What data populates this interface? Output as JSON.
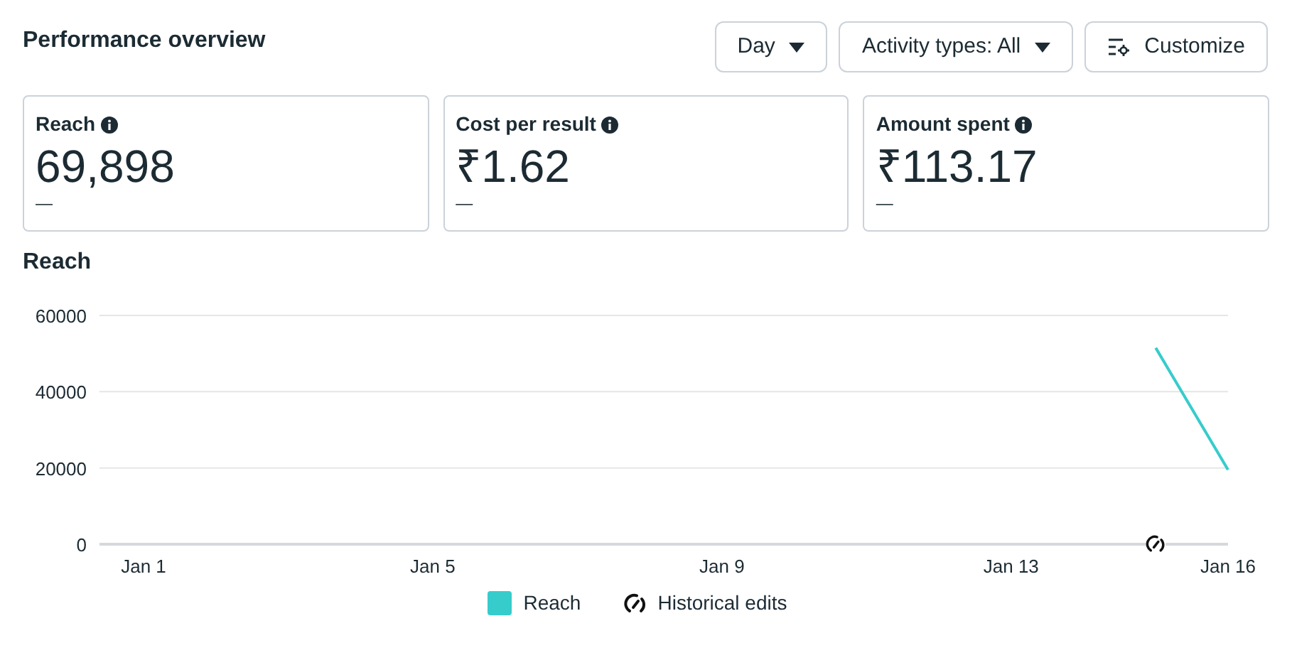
{
  "title": "Performance overview",
  "controls": [
    {
      "kind": "dropdown",
      "label": "Day"
    },
    {
      "kind": "dropdown",
      "label": "Activity types: All"
    },
    {
      "kind": "customize",
      "label": "Customize"
    }
  ],
  "metrics": [
    {
      "label": "Reach",
      "value": "69,898",
      "change": "—"
    },
    {
      "label": "Cost per result",
      "value": "₹1.62",
      "change": "—"
    },
    {
      "label": "Amount spent",
      "value": "₹113.17",
      "change": "—"
    }
  ],
  "chart_section": {
    "title": "Reach",
    "edits_legend": "Historical edits",
    "chart_data": {
      "type": "line",
      "categories": [
        "Jan 1",
        null,
        null,
        null,
        "Jan 5",
        null,
        null,
        null,
        "Jan 9",
        null,
        null,
        null,
        "Jan 13",
        null,
        null,
        "Jan 16"
      ],
      "series": [
        {
          "name": "Reach",
          "color": "#36cccc",
          "values": [
            null,
            null,
            null,
            null,
            null,
            null,
            null,
            null,
            null,
            null,
            null,
            null,
            null,
            null,
            51500,
            19500
          ]
        }
      ],
      "ylim": [
        0,
        60000
      ],
      "yticks": [
        0,
        20000,
        40000,
        60000
      ]
    },
    "edit_marker": true
  }
}
